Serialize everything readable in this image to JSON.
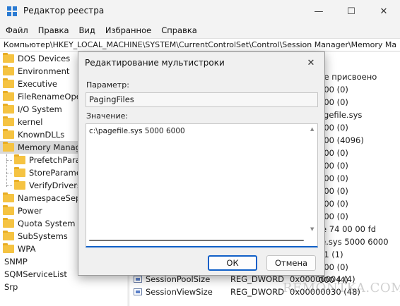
{
  "window": {
    "title": "Редактор реестра",
    "minimize": "—",
    "maximize": "☐",
    "close": "✕"
  },
  "menu": [
    "Файл",
    "Правка",
    "Вид",
    "Избранное",
    "Справка"
  ],
  "address": "Компьютер\\HKEY_LOCAL_MACHINE\\SYSTEM\\CurrentControlSet\\Control\\Session Manager\\Memory Ma",
  "tree": [
    {
      "label": "DOS Devices",
      "indent": 0,
      "selected": false
    },
    {
      "label": "Environment",
      "indent": 0,
      "selected": false
    },
    {
      "label": "Executive",
      "indent": 0,
      "selected": false
    },
    {
      "label": "FileRenameOper",
      "indent": 0,
      "selected": false
    },
    {
      "label": "I/O System",
      "indent": 0,
      "selected": false
    },
    {
      "label": "kernel",
      "indent": 0,
      "selected": false
    },
    {
      "label": "KnownDLLs",
      "indent": 0,
      "selected": false
    },
    {
      "label": "Memory Manag",
      "indent": 0,
      "selected": true
    },
    {
      "label": "PrefetchParar",
      "indent": 1,
      "selected": false
    },
    {
      "label": "StoreParamet",
      "indent": 1,
      "selected": false
    },
    {
      "label": "VerifyDrivers",
      "indent": 1,
      "selected": false
    },
    {
      "label": "NamespaceSepa",
      "indent": 0,
      "selected": false
    },
    {
      "label": "Power",
      "indent": 0,
      "selected": false
    },
    {
      "label": "Quota System",
      "indent": 0,
      "selected": false
    },
    {
      "label": "SubSystems",
      "indent": 0,
      "selected": false
    },
    {
      "label": "WPA",
      "indent": 0,
      "selected": false
    },
    {
      "label": "SNMP",
      "indent": -1,
      "selected": false
    },
    {
      "label": "SQMServiceList",
      "indent": -1,
      "selected": false
    },
    {
      "label": "Srp",
      "indent": -1,
      "selected": false
    }
  ],
  "right_values": [
    "не присвоено",
    "000 (0)",
    "000 (0)",
    "agefile.sys",
    "000 (0)",
    "000 (4096)",
    "000 (0)",
    "000 (0)",
    "000 (0)",
    "000 (0)",
    "000 (0)",
    "000 (0)",
    "fe 74 00 00 fd",
    "le.sys 5000 6000",
    "01 (1)",
    "000 (0)",
    "000 (4)"
  ],
  "bottom_rows": [
    {
      "name": "SessionPoolSize",
      "type": "REG_DWORD",
      "data": "0x00000004 (4)"
    },
    {
      "name": "SessionViewSize",
      "type": "REG_DWORD",
      "data": "0x00000030 (48)"
    }
  ],
  "dialog": {
    "title": "Редактирование мультистроки",
    "close": "✕",
    "param_label": "Параметр:",
    "param_value": "PagingFiles",
    "value_label": "Значение:",
    "value_text": "c:\\pagefile.sys 5000 6000",
    "ok_label": "ОК",
    "cancel_label": "Отмена"
  },
  "watermark": "REMONTKA.COM",
  "colors": {
    "accent": "#1060c8",
    "folder": "#f5c342"
  }
}
